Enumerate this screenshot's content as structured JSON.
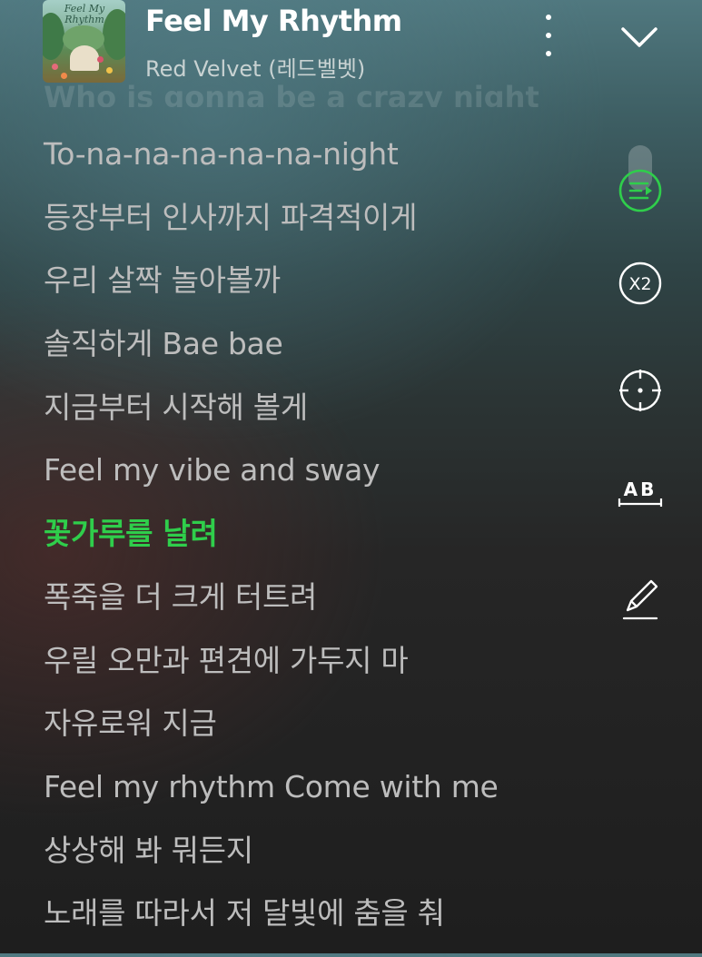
{
  "header": {
    "album_art_title": "Feel My Rhythm",
    "song_title": "Feel My Rhythm",
    "artist": "Red Velvet (레드벨벳)",
    "more_icon": "more-vertical-icon",
    "collapse_icon": "chevron-down-icon"
  },
  "lyrics": {
    "previous_faded": "Who is gonna be a crazy night",
    "active_index": 6,
    "lines": [
      "To-na-na-na-na-na-night",
      "등장부터 인사까지 파격적이게",
      "우리 살짝 놀아볼까",
      "솔직하게 Bae bae",
      "지금부터 시작해 볼게",
      "Feel my vibe and sway",
      "꽃가루를 날려",
      "폭죽을 더 크게 터트려",
      "우릴 오만과 편견에 가두지 마",
      "자유로워 지금",
      "Feel my rhythm Come with me",
      "상상해 봐 뭐든지",
      "노래를 따라서 저 달빛에 춤을 춰"
    ]
  },
  "side_controls": {
    "sync_icon": "lyrics-sync-icon",
    "speed_label": "X2",
    "locate_icon": "crosshair-icon",
    "ab_label": "AB",
    "edit_icon": "pencil-underline-icon"
  },
  "colors": {
    "accent": "#2fce4b",
    "lyric_text": "#bdbdbd",
    "title_text": "#ffffff"
  }
}
